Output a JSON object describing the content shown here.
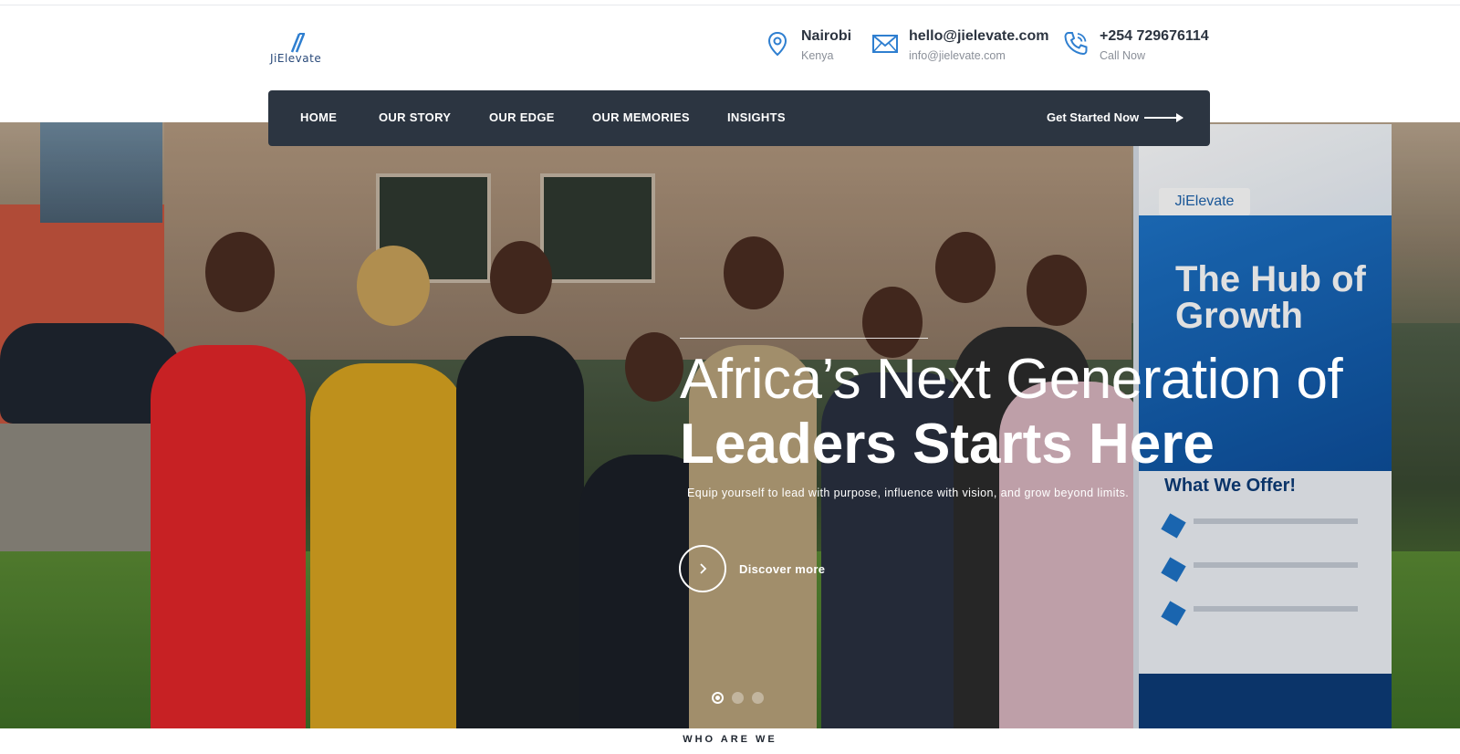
{
  "brand": {
    "logo_text": "JiElevate"
  },
  "contacts": [
    {
      "title": "Nairobi",
      "subtitle": "Kenya",
      "icon": "location-pin-icon"
    },
    {
      "title": "hello@jielevate.com",
      "subtitle": "info@jielevate.com",
      "icon": "envelope-icon"
    },
    {
      "title": "+254 729676114",
      "subtitle": "Call Now",
      "icon": "phone-icon"
    }
  ],
  "nav": {
    "items": [
      "HOME",
      "OUR STORY",
      "OUR EDGE",
      "OUR MEMORIES",
      "INSIGHTS"
    ],
    "cta": "Get Started Now"
  },
  "hero": {
    "line1": "Africa’s Next Generation of",
    "line2": "Leaders Starts Here",
    "lead": "Equip yourself to lead with purpose, influence with vision, and grow beyond limits.",
    "discover": "Discover more",
    "slides": 3,
    "active_slide": 1,
    "banner": {
      "logo": "JiElevate",
      "title": "The Hub of Growth",
      "offer": "What We Offer!"
    }
  },
  "section": {
    "label": "WHO ARE WE"
  },
  "colors": {
    "nav_bg": "#2c3541",
    "accent": "#1e74c8",
    "text_dark": "#2c3440"
  }
}
